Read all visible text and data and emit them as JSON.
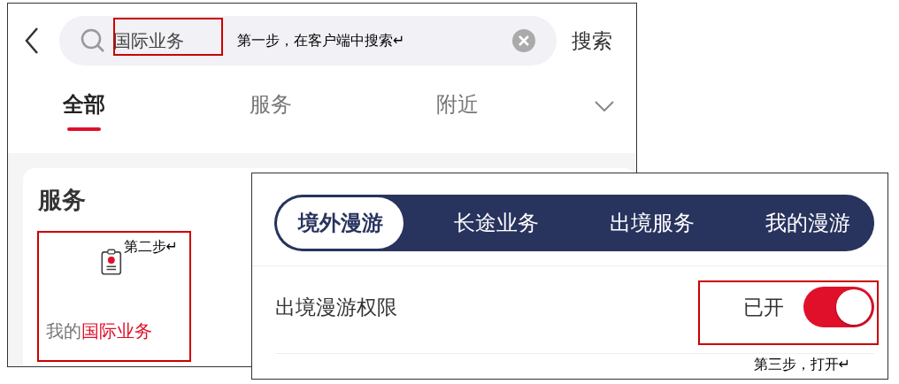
{
  "search_screen": {
    "search": {
      "value": "国际业务",
      "annotation": "第一步，在客户端中搜索↵"
    },
    "search_button": "搜索",
    "tabs": [
      {
        "label": "全部",
        "selected": true
      },
      {
        "label": "服务",
        "selected": false
      },
      {
        "label": "附近",
        "selected": false
      }
    ],
    "section_title": "服务",
    "service": {
      "label_parts": [
        {
          "text": "我的",
          "highlight": false
        },
        {
          "text": "国际业务",
          "highlight": true
        }
      ],
      "annotation": "第二步↵"
    }
  },
  "roaming_screen": {
    "tabs": [
      {
        "label": "境外漫游",
        "selected": true
      },
      {
        "label": "长途业务",
        "selected": false
      },
      {
        "label": "出境服务",
        "selected": false
      },
      {
        "label": "我的漫游",
        "selected": false
      }
    ],
    "setting": {
      "label": "出境漫游权限",
      "status": "已开",
      "on": true,
      "annotation": "第三步，打开↵"
    }
  }
}
